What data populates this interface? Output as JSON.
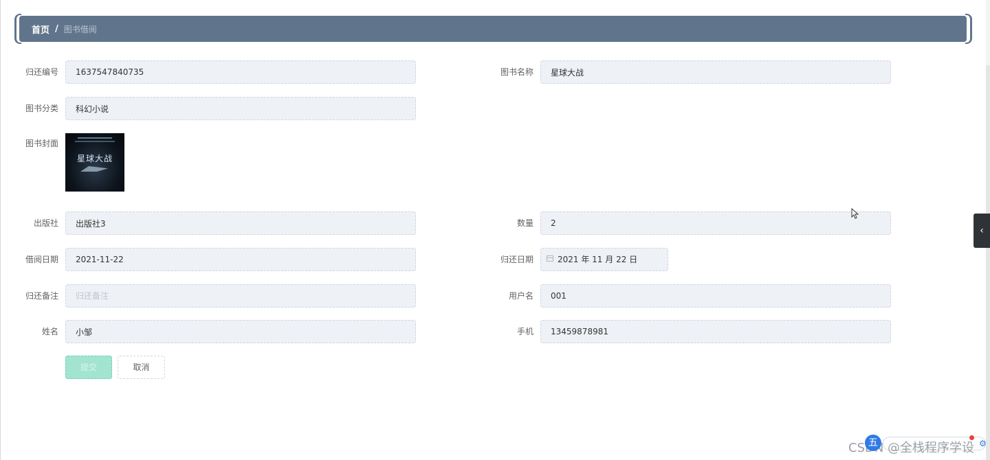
{
  "breadcrumb": {
    "home": "首页",
    "separator": "/",
    "current": "图书借阅"
  },
  "form": {
    "return_no": {
      "label": "归还编号",
      "value": "1637547840735"
    },
    "book_name": {
      "label": "图书名称",
      "value": "星球大战"
    },
    "book_category": {
      "label": "图书分类",
      "value": "科幻小说"
    },
    "book_cover": {
      "label": "图书封面",
      "cover_title": "星球大战"
    },
    "publisher": {
      "label": "出版社",
      "value": "出版社3"
    },
    "quantity": {
      "label": "数量",
      "value": "2"
    },
    "borrow_date": {
      "label": "借阅日期",
      "value": "2021-11-22"
    },
    "return_date": {
      "label": "归还日期",
      "value": "2021 年 11 月 22 日"
    },
    "return_note": {
      "label": "归还备注",
      "value": "",
      "placeholder": "归还备注"
    },
    "username": {
      "label": "用户名",
      "value": "001"
    },
    "name": {
      "label": "姓名",
      "value": "小邹"
    },
    "phone": {
      "label": "手机",
      "value": "13459878981"
    }
  },
  "buttons": {
    "submit": "提交",
    "cancel": "取消"
  },
  "side_toggle": "‹",
  "watermark": {
    "badge": "五",
    "text": "CSDN @全栈程序学设"
  },
  "colors": {
    "breadcrumb_bg": "#60758c",
    "field_bg": "#eef1f5",
    "submit_bg": "#a3e4d1"
  }
}
